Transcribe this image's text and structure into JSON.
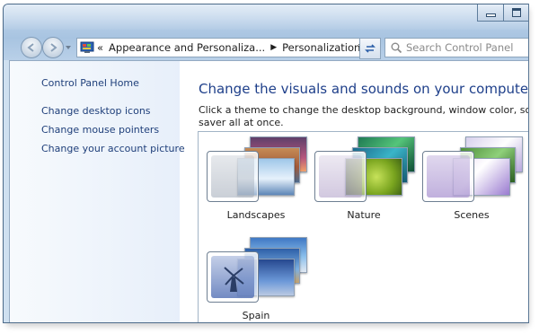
{
  "window": {
    "titlebar_buttons": [
      "minimize",
      "maximize"
    ]
  },
  "toolbar": {
    "back_icon": "back-arrow-icon",
    "forward_icon": "forward-arrow-icon",
    "address": {
      "prefix": "«",
      "crumbs": [
        "Appearance and Personaliza...",
        "Personalization"
      ]
    },
    "search": {
      "placeholder": "Search Control Panel"
    }
  },
  "sidebar": {
    "items": [
      {
        "label": "Control Panel Home"
      },
      {
        "label": "Change desktop icons"
      },
      {
        "label": "Change mouse pointers"
      },
      {
        "label": "Change your account picture"
      }
    ]
  },
  "main": {
    "title": "Change the visuals and sounds on your computer",
    "description_line1": "Click a theme to change the desktop background, window color, sounds, and sc",
    "description_line2": "saver all at once.",
    "themes": [
      {
        "label": "Landscapes",
        "tint": "#9ea8b6"
      },
      {
        "label": "Nature",
        "tint": "#a592c0"
      },
      {
        "label": "Scenes",
        "tint": "#a68fcf"
      },
      {
        "label": "Spain",
        "tint": "#7d95cc"
      }
    ]
  }
}
